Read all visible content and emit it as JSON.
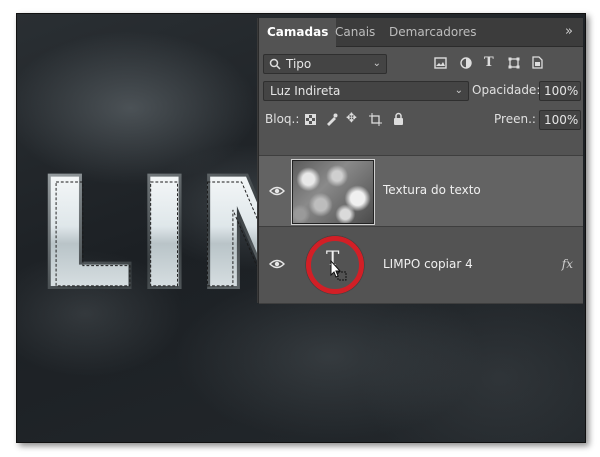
{
  "panel": {
    "tabs": [
      {
        "label": "Camadas",
        "active": true
      },
      {
        "label": "Canais",
        "active": false
      },
      {
        "label": "Demarcadores",
        "active": false
      }
    ],
    "more_glyph": "»"
  },
  "filter": {
    "search_icon": "search-icon",
    "kind_value": "Tipo",
    "filter_icons": [
      "image-filter-icon",
      "adjustment-filter-icon",
      "type-filter-icon",
      "shape-filter-icon",
      "smart-object-filter-icon"
    ]
  },
  "blend": {
    "mode_value": "Luz Indireta",
    "opacity_label": "Opacidade:",
    "opacity_value": "100%"
  },
  "lock": {
    "label": "Bloq.:",
    "lock_icons": [
      "lock-transparent-pixels-icon",
      "lock-image-pixels-icon",
      "lock-position-icon",
      "lock-artboard-icon",
      "lock-all-icon"
    ],
    "fill_label": "Preen.:",
    "fill_value": "100%"
  },
  "layers": [
    {
      "name": "Textura do texto",
      "type": "pixel",
      "selected": true,
      "visible": true
    },
    {
      "name": "LIMPO copiar 4",
      "type": "text",
      "selected": false,
      "visible": true,
      "fx": "fx"
    }
  ],
  "canvas_text": "LIM",
  "colors": {
    "panel_bg": "#535353",
    "tab_bar": "#3c3c3c",
    "selected_layer": "#636363",
    "highlight_ring": "#d21f26"
  }
}
